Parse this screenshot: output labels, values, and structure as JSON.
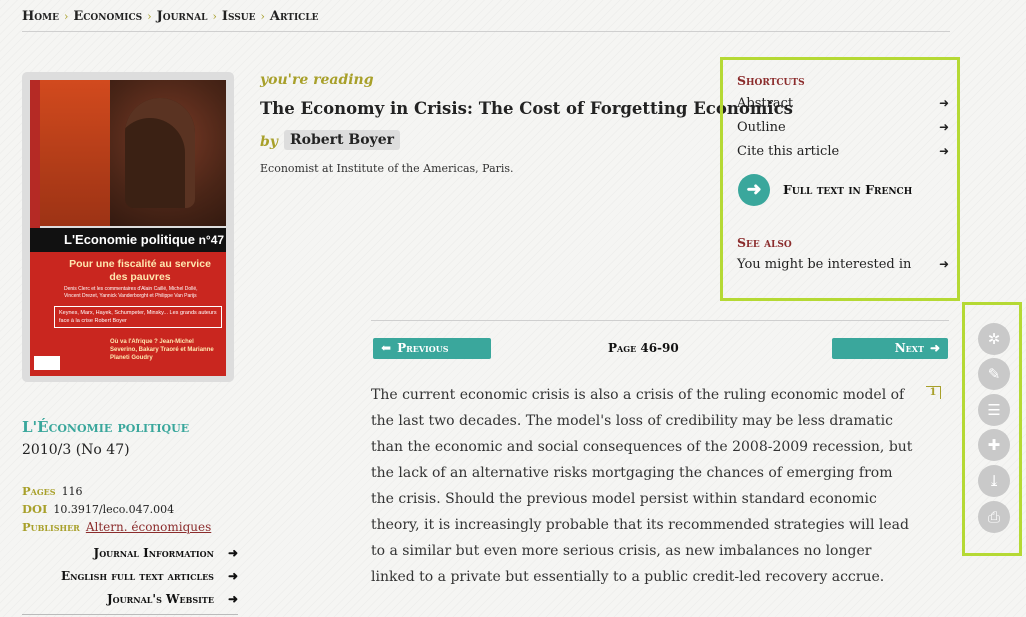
{
  "breadcrumb": {
    "items": [
      "Home",
      "Economics",
      "Journal",
      "Issue",
      "Article"
    ],
    "separator": "›"
  },
  "cover": {
    "journal": "L'Economie politique",
    "issue_num": "n°47",
    "headline": "Pour une fiscalité au service des pauvres",
    "contributors": "Denis Clerc et les commentaires d'Alain Caillé, Michel Dollé, Vincent Drezet, Yannick Vanderborght et Philippe Van Parijs",
    "box_text": "Keynes, Marx, Hayek, Schumpeter, Minsky... Les grands auteurs face à la crise",
    "box_author": "Robert Boyer",
    "sub_headline": "Où va l'Afrique ? Jean-Michel Severino, Bakary Traoré et Marianne Planeti Goudry"
  },
  "journal": {
    "name": "L'Économie politique",
    "issue": "2010/3 (No 47)",
    "pages_label": "Pages",
    "pages_value": "116",
    "doi_label": "DOI",
    "doi_value": "10.3917/leco.047.004",
    "publisher_label": "Publisher",
    "publisher_value": "Altern. économiques",
    "links": [
      "Journal Information",
      "English full text articles",
      "Journal's Website"
    ]
  },
  "article": {
    "reading_label": "you're reading",
    "title": "The Economy in Crisis: The Cost of Forgetting Economics",
    "by_label": "by",
    "author": "Robert Boyer",
    "affiliation": "Economist at Institute of the Americas, Paris."
  },
  "shortcuts": {
    "title": "Shortcuts",
    "items": [
      "Abstract",
      "Outline",
      "Cite this article"
    ],
    "full_text": "Full text in French",
    "see_also_title": "See also",
    "see_also_item": "You might be interested in"
  },
  "pager": {
    "previous": "Previous",
    "page": "Page 46-90",
    "next": "Next"
  },
  "body": {
    "text": "The current economic crisis is also a crisis of the ruling economic model of the last two decades. The model's loss of credibility may be less dramatic than the economic and social consequences of the 2008-2009 recession, but the lack of an alternative risks mortgaging the chances of emerging from the crisis. Should the previous model persist within standard economic theory, it is increasingly probable that its recommended strategies will lead to a similar but even more serious crisis, as new imbalances no longer linked to a private but essentially to a public credit-led recovery accrue.",
    "note_number": "1"
  },
  "tools": [
    "share-icon",
    "annotate-icon",
    "outline-toggle-icon",
    "bookmark-add-icon",
    "pdf-icon",
    "print-icon"
  ],
  "colors": {
    "teal": "#3aa79c",
    "olive": "#a8a02a",
    "maroon": "#8b2c2c",
    "highlight": "#b5d934"
  }
}
